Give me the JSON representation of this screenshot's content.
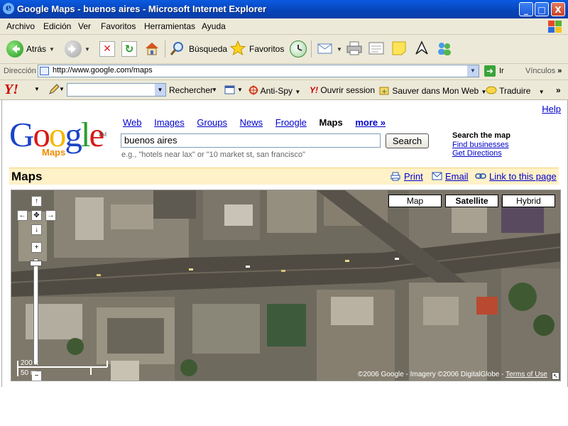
{
  "window": {
    "title": "Google Maps - buenos aires - Microsoft Internet Explorer",
    "minimize": "_",
    "maximize": "□",
    "close": "X"
  },
  "menu": [
    "Archivo",
    "Edición",
    "Ver",
    "Favoritos",
    "Herramientas",
    "Ayuda"
  ],
  "toolbar": {
    "back_label": "Atrás",
    "search_label": "Búsqueda",
    "favorites_label": "Favoritos"
  },
  "address": {
    "label": "Dirección",
    "url": "http://www.google.com/maps",
    "go_label": "Ir",
    "links_label": "Vínculos",
    "overflow": "»"
  },
  "yahoo_toolbar": {
    "logo": "Y!",
    "search_button": "Rechercher",
    "antispy": "Anti-Spy",
    "signin": "Ouvrir session",
    "save_web": "Sauver dans Mon Web",
    "translate": "Traduire",
    "overflow": "»"
  },
  "google": {
    "help": "Help",
    "logo": {
      "G": "G",
      "o1": "o",
      "o2": "o",
      "g": "g",
      "l": "l",
      "e": "e",
      "tm": "TM"
    },
    "product": "Maps",
    "nav": {
      "web": "Web",
      "images": "Images",
      "groups": "Groups",
      "news": "News",
      "froogle": "Froogle",
      "maps": "Maps",
      "more": "more »"
    },
    "query": "buenos aires",
    "search_button": "Search",
    "hint": "e.g., \"hotels near lax\" or \"10 market st, san francisco\"",
    "search_map": {
      "title": "Search the map",
      "find_businesses": "Find businesses",
      "get_directions": "Get Directions"
    },
    "maps_bar": {
      "heading": "Maps",
      "print": "Print",
      "email": "Email",
      "link": "Link to this page"
    }
  },
  "map": {
    "types": [
      "Map",
      "Satellite",
      "Hybrid"
    ],
    "selected_type": "Satellite",
    "scale_ft": "200 ft",
    "scale_m": "50 m",
    "copyright": "©2006 Google - Imagery ©2006 DigitalGlobe -",
    "terms": "Terms of Use"
  }
}
